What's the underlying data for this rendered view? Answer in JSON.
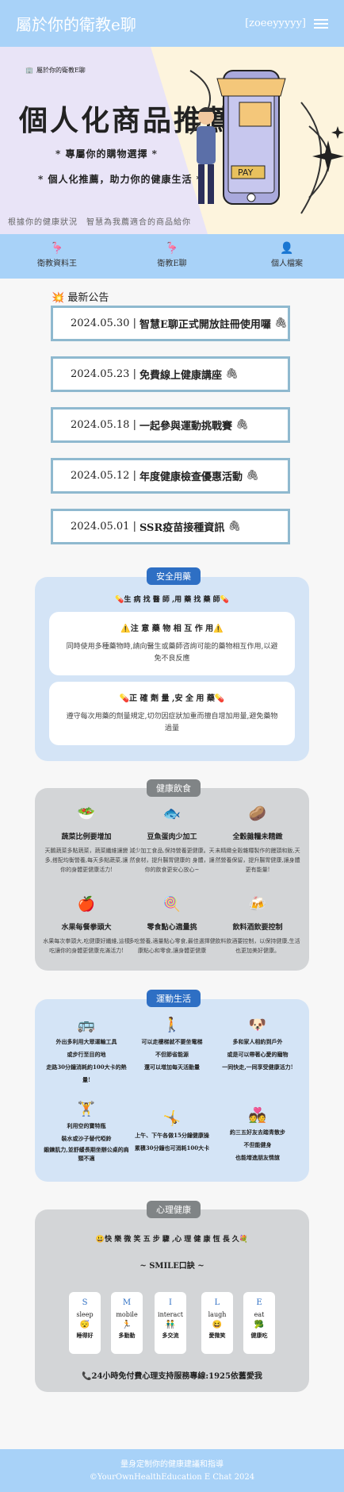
{
  "header": {
    "title": "屬於你的衛教e聊",
    "user": "[zoeeyyyyy]"
  },
  "banner": {
    "logo": "屬於你的衛教E聊",
    "title": "個人化商品推薦",
    "line1": "* 專屬你的購物選擇 *",
    "line2": "* 個人化推薦，助力你的健康生活 *",
    "tagline": "根據你的健康狀況　智慧為我薦適合的商品給你",
    "pay": "PAY"
  },
  "nav": [
    {
      "icon": "🦩",
      "label": "衛教資料王"
    },
    {
      "icon": "🦩",
      "label": "衛教E聊"
    },
    {
      "icon": "👤",
      "label": "個人檔案"
    }
  ],
  "announcements": {
    "heading": "最新公告",
    "items": [
      {
        "date": "2024.05.30",
        "title": "智慧E聊正式開放註冊使用囉"
      },
      {
        "date": "2024.05.23",
        "title": "免費線上健康講座"
      },
      {
        "date": "2024.05.18",
        "title": "一起參與運動挑戰賽"
      },
      {
        "date": "2024.05.12",
        "title": "年度健康檢查優惠活動"
      },
      {
        "date": "2024.05.01",
        "title": "SSR疫苗接種資訊"
      }
    ]
  },
  "safe": {
    "badge": "安全用藥",
    "subtitle": "💊生 病 找 醫 師 ,用 藥 找 藥 師💊",
    "boxes": [
      {
        "title": "⚠️注 意 藥 物 相 互 作 用⚠️",
        "text": "同時使用多種藥物時,請向醫生或藥師咨詢可能的藥物相互作用,以避免不良反應"
      },
      {
        "title": "💊正 確 劑 量 ,安 全 用 藥💊",
        "text": "遵守每次用藥的劑量規定,切勿因症狀加重而擅自增加用量,避免藥物過量"
      }
    ]
  },
  "diet": {
    "badge": "健康飲食",
    "items": [
      {
        "icon": "🥗",
        "title": "蔬菜比例要增加",
        "text": "天鵝蔬菜多點蔬菜，蔬菜纖維讓變多,搭配均衡營養,每天多點蔬菜,讓你的身體更健康活力!"
      },
      {
        "icon": "🐟",
        "title": "豆魚蛋肉少加工",
        "text": "減少加工食品,保持營養更健康。天然食材，提升腸胃健康的 身體，讓你的飲食更安心放心~"
      },
      {
        "icon": "🥔",
        "title": "全穀雜糧未精緻",
        "text": "未精緻全穀雜糧製作的饅頭和飯,天然營養保留，提升腸胃健康,讓身體更有能量!"
      },
      {
        "icon": "🍎",
        "title": "水果每餐拳頭大",
        "text": "水果每次拳頭大,吃健康好纖維,這樣吃讓你的身體更健康充滿活力!"
      },
      {
        "icon": "🍭",
        "title": "零食點心適量挑",
        "text": "多吃營養,適量點心零食,最佳選擇健康點心和零食,讓身體更健康"
      },
      {
        "icon": "🍻",
        "title": "飲料酒飲要控制",
        "text": "飲料飲酒要控制，以保持健康,生活也更加美好健康。"
      }
    ]
  },
  "exercise": {
    "badge": "運動生活",
    "items": [
      {
        "icon": "🚌",
        "lines": [
          "外出多利用大眾運輸工具",
          "或步行至目的地",
          "走路30分鐘消耗約100大卡的熱量!"
        ]
      },
      {
        "icon": "🚶",
        "lines": [
          "可以走樓梯就不要坐電梯",
          "不但節省能源",
          "還可以增加每天活動量"
        ]
      },
      {
        "icon": "🐶",
        "lines": [
          "多和家人相約到戶外",
          "或是可以帶著心愛的寵物",
          "一同快走,一同享受健康活力!"
        ]
      },
      {
        "icon": "🏋️",
        "lines": [
          "利用空的寶特瓶",
          "裝水或沙子替代啞鈴",
          "鍛鍊肌力,並舒緩長期坐辦公桌的肩頸不適"
        ]
      },
      {
        "icon": "🤸",
        "lines": [
          "上午、下午各做15分鐘健康操",
          "累積30分鐘也可消耗100大卡"
        ]
      },
      {
        "icon": "💑",
        "lines": [
          "約三五好友去踏青散步",
          "不但能健身",
          "也能增進朋友情誼"
        ]
      }
    ]
  },
  "mental": {
    "badge": "心理健康",
    "subtitle": "😃快 樂 微 笑 五 步 驟 ,心 理 健 康 恆 長 久💐",
    "smile_title": "~ SMILE口訣 ~",
    "cards": [
      {
        "letter": "S",
        "word": "sleep",
        "emoji": "😴",
        "cn": "睡得好"
      },
      {
        "letter": "M",
        "word": "mobile",
        "emoji": "🏃",
        "cn": "多動動"
      },
      {
        "letter": "I",
        "word": "interact",
        "emoji": "👬",
        "cn": "多交流"
      },
      {
        "letter": "L",
        "word": "laugh",
        "emoji": "😆",
        "cn": "愛微笑"
      },
      {
        "letter": "E",
        "word": "eat",
        "emoji": "🥦",
        "cn": "健康吃"
      }
    ],
    "hotline": "📞24小時免付費心理支持服務專線:1925依舊愛我"
  },
  "footer": {
    "line1": "量身定制你的健康建議和指導",
    "line2": "©YourOwnHealthEducation E Chat 2024"
  },
  "colors": {
    "primary": "#a8d2f8",
    "blue_badge": "#2e6fc4",
    "gray_badge": "#808486",
    "section_blue": "#d4e4f6",
    "section_gray": "#d3d5d7",
    "card_border": "#8fb9cf"
  }
}
